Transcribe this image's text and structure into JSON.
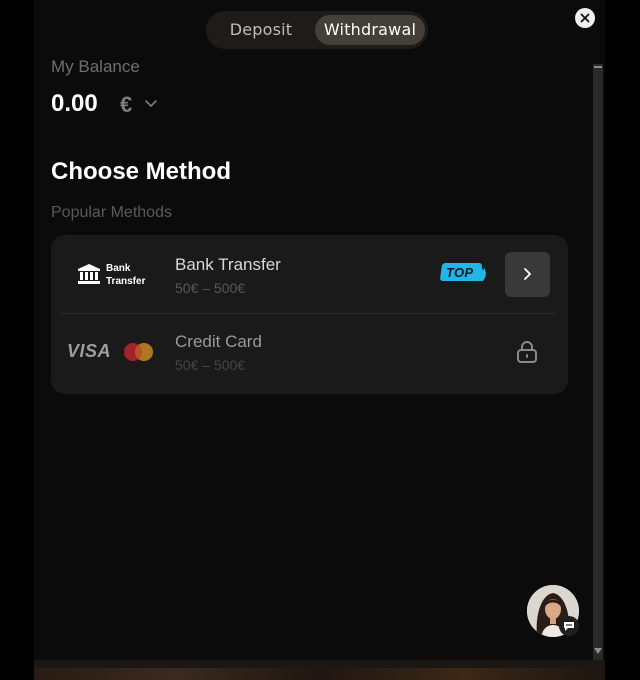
{
  "tabs": {
    "deposit": "Deposit",
    "withdrawal": "Withdrawal",
    "active": "Withdrawal"
  },
  "balance": {
    "label": "My Balance",
    "amount": "0.00",
    "currency": "€"
  },
  "section": {
    "title": "Choose Method",
    "subtitle": "Popular Methods"
  },
  "methods": [
    {
      "logo_line1": "Bank",
      "logo_line2": "Transfer",
      "name": "Bank Transfer",
      "range": "50€ – 500€",
      "badge": "TOP",
      "status": "available"
    },
    {
      "logo_visa": "VISA",
      "name": "Credit Card",
      "range": "50€ – 500€",
      "status": "locked"
    }
  ],
  "colors": {
    "panel_bg": "#0c0b0b",
    "card_bg": "#1b1a1a",
    "badge": "#22b6e8",
    "active_tab": "#444039"
  },
  "icons": {
    "close": "close-icon",
    "currency_dropdown": "chevron-down-icon",
    "bank": "bank-icon",
    "arrow": "chevron-right-icon",
    "lock": "lock-icon",
    "chat": "chat-icon"
  }
}
